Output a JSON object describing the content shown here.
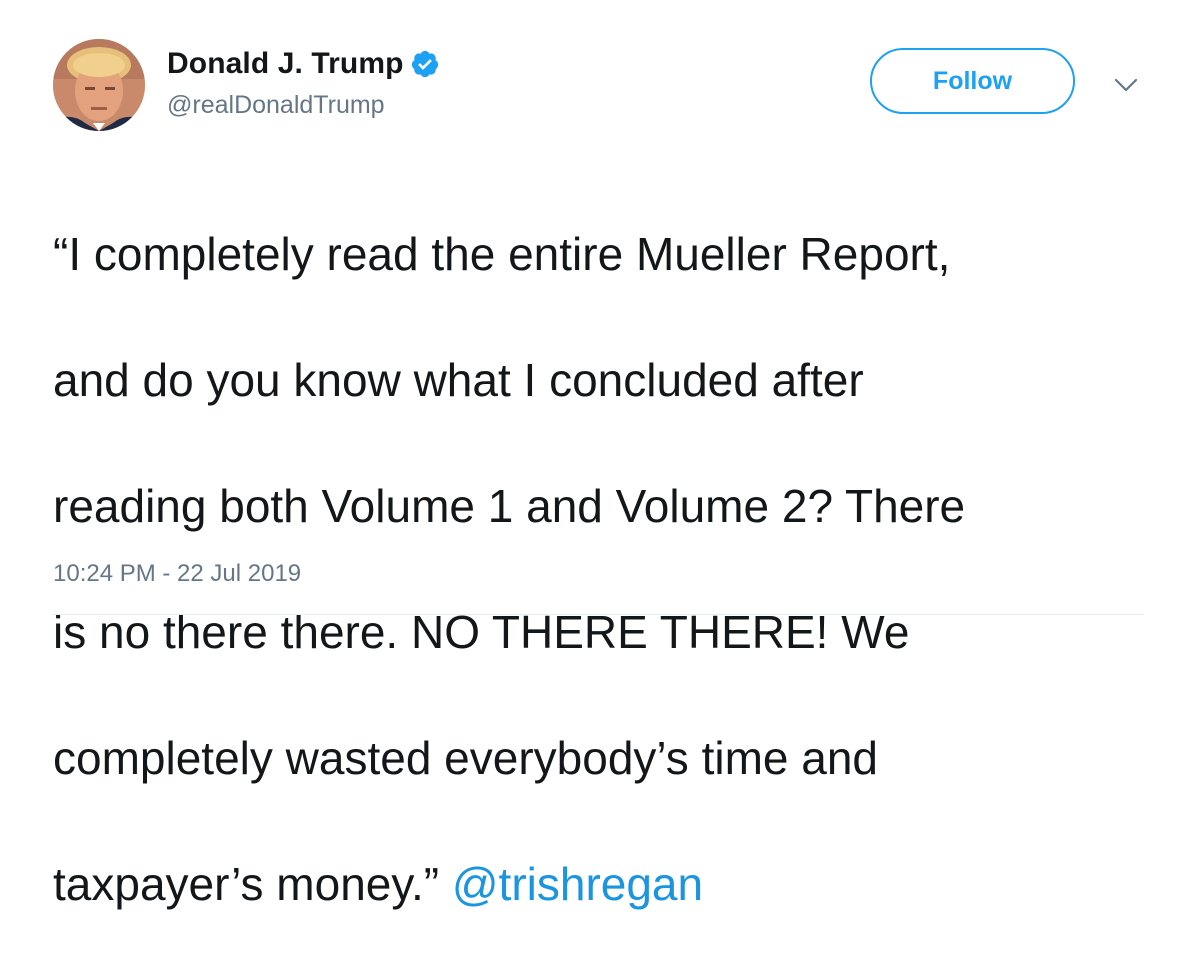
{
  "user": {
    "display_name": "Donald J. Trump",
    "handle": "@realDonaldTrump",
    "verified": true,
    "avatar_icon": "profile-photo"
  },
  "actions": {
    "follow_label": "Follow",
    "menu_icon": "chevron-down-icon"
  },
  "tweet": {
    "lines": [
      "“I completely read the entire Mueller Report,",
      "and do you know what I concluded after",
      "reading both Volume 1 and Volume 2? There",
      "is no there there. NO THERE THERE! We",
      "completely wasted everybody’s time and"
    ],
    "last_line_text": "taxpayer’s money.” ",
    "mention": "@trishregan",
    "timestamp": "10:24 PM - 22 Jul 2019"
  },
  "colors": {
    "accent": "#1da1f2",
    "mention": "#1b95e0",
    "secondary_text": "#657786",
    "primary_text": "#14171a"
  }
}
